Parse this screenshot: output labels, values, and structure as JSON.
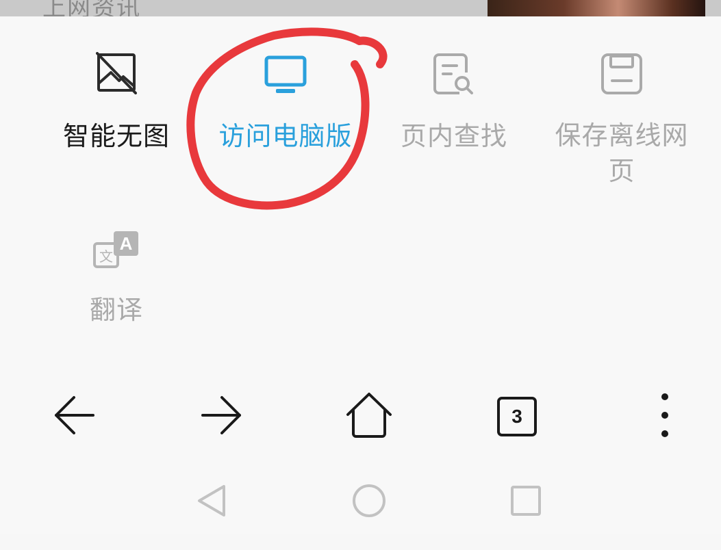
{
  "background_page": {
    "partial_text": "上网资讯"
  },
  "menu": {
    "items": [
      {
        "label": "智能无图",
        "icon": "no-image-icon",
        "state": "active"
      },
      {
        "label": "访问电脑版",
        "icon": "desktop-monitor-icon",
        "state": "highlighted"
      },
      {
        "label": "页内查找",
        "icon": "find-in-page-icon",
        "state": "disabled"
      },
      {
        "label": "保存离线网页",
        "icon": "save-offline-icon",
        "state": "disabled"
      },
      {
        "label": "翻译",
        "icon": "translate-icon",
        "state": "disabled",
        "icon_letter": "A"
      }
    ]
  },
  "navbar": {
    "back": "back-arrow-icon",
    "forward": "forward-arrow-icon",
    "home": "home-icon",
    "tabs_count": "3",
    "more": "more-vertical-icon"
  },
  "system_nav": [
    "back-triangle-icon",
    "home-circle-icon",
    "recents-square-icon"
  ],
  "colors": {
    "highlight_blue": "#2aa0dc",
    "disabled_gray": "#a9a9a9",
    "annotation_red": "#e8393c"
  }
}
